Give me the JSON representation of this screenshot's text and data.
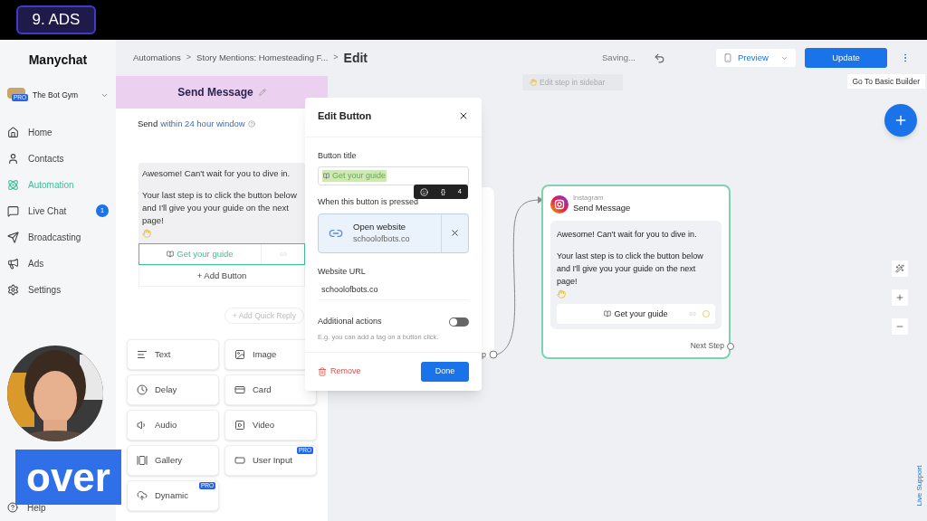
{
  "video_overlay": {
    "chapter": "9. ADS",
    "caption": "over"
  },
  "sidebar": {
    "logo": "Manychat",
    "account": {
      "name": "The Bot Gym",
      "badge": "PRO"
    },
    "items": [
      {
        "label": "Home",
        "selected": false
      },
      {
        "label": "Contacts",
        "selected": false
      },
      {
        "label": "Automation",
        "selected": true
      },
      {
        "label": "Live Chat",
        "selected": false,
        "count": "1"
      },
      {
        "label": "Broadcasting",
        "selected": false
      },
      {
        "label": "Ads",
        "selected": false
      },
      {
        "label": "Settings",
        "selected": false
      }
    ],
    "help": "Help"
  },
  "header": {
    "breadcrumbs": [
      {
        "label": "Automations",
        "separator": ">"
      },
      {
        "label": "Story Mentions: Homesteading F...",
        "separator": ">"
      }
    ],
    "current": "Edit",
    "status": "Saving...",
    "preview": "Preview",
    "update": "Update"
  },
  "panel": {
    "title": "Send Message",
    "send_prefix": "Send",
    "send_window": "within 24 hour window",
    "message": [
      "Awesome! Can't wait for you to dive in.",
      "Your last step is to click the button below and I'll give you your guide on the next page!"
    ],
    "button": "Get your guide",
    "add_button": "+ Add Button",
    "add_quick_reply": "+ Add Quick Reply",
    "blocks": [
      {
        "label": "Text"
      },
      {
        "label": "Image"
      },
      {
        "label": "Delay"
      },
      {
        "label": "Card"
      },
      {
        "label": "Audio"
      },
      {
        "label": "Video"
      },
      {
        "label": "Gallery"
      },
      {
        "label": "User Input",
        "badge": "PRO"
      },
      {
        "label": "Dynamic",
        "badge": "PRO"
      }
    ]
  },
  "edit_button": {
    "title": "Edit Button",
    "title_label": "Button title",
    "title_value": "Get your guide",
    "toolbar": {
      "vars": "{}",
      "count": "4"
    },
    "pressed_label": "When this button is pressed",
    "action": {
      "title": "Open website",
      "subtitle": "schoolofbots.co"
    },
    "url_label": "Website URL",
    "url_value": "schoolofbots.co",
    "additional_label": "Additional actions",
    "additional_on": false,
    "additional_hint": "E.g. you can add a tag on a button click.",
    "remove": "Remove",
    "done": "Done"
  },
  "canvas": {
    "hint": "Edit step in sidebar",
    "basic_builder": "Go To Basic Builder",
    "hidden_node_text": "p",
    "live_support": "Live Support",
    "node": {
      "channel": "Instagram",
      "title": "Send Message",
      "message": [
        "Awesome! Can't wait for you to dive in.",
        "Your last step is to click the button below and I'll give you your guide on the next page!"
      ],
      "button": "Get your guide",
      "next": "Next Step"
    }
  }
}
